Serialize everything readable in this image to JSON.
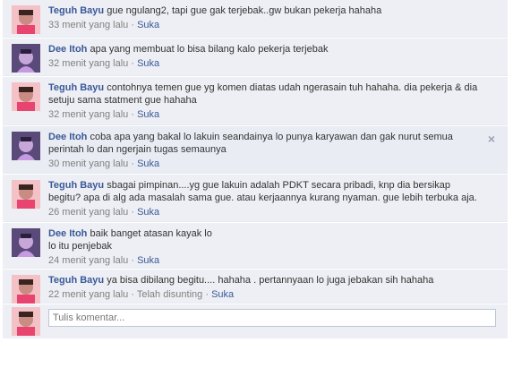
{
  "comments": [
    {
      "author": "Teguh Bayu",
      "avatar": "teguh",
      "text": "gue ngulang2, tapi gue gak terjebak..gw bukan pekerja hahaha",
      "time": "33 menit yang lalu",
      "like": "Suka",
      "extra": ""
    },
    {
      "author": "Dee Itoh",
      "avatar": "dee",
      "text": "apa yang membuat lo bisa bilang kalo pekerja terjebak",
      "time": "32 menit yang lalu",
      "like": "Suka",
      "extra": ""
    },
    {
      "author": "Teguh Bayu",
      "avatar": "teguh",
      "text": "contohnya temen gue yg komen diatas udah ngerasain tuh hahaha. dia pekerja & dia setuju sama statment gue hahaha",
      "time": "32 menit yang lalu",
      "like": "Suka",
      "extra": ""
    },
    {
      "author": "Dee Itoh",
      "avatar": "dee",
      "text": "coba apa yang bakal lo lakuin seandainya lo punya karyawan dan gak nurut semua perintah lo dan ngerjain tugas semaunya",
      "time": "30 menit yang lalu",
      "like": "Suka",
      "extra": ""
    },
    {
      "author": "Teguh Bayu",
      "avatar": "teguh",
      "text": "sbagai pimpinan....yg gue lakuin adalah PDKT secara pribadi, knp dia bersikap begitu? apa di alg ada masalah sama gue. atau kerjaannya kurang nyaman. gue lebih terbuka aja.",
      "time": "26 menit yang lalu",
      "like": "Suka",
      "extra": ""
    },
    {
      "author": "Dee Itoh",
      "avatar": "dee",
      "text": "baik banget atasan kayak lo\nlo itu penjebak",
      "time": "24 menit yang lalu",
      "like": "Suka",
      "extra": ""
    },
    {
      "author": "Teguh Bayu",
      "avatar": "teguh",
      "text": "ya bisa dibilang begitu.... hahaha . pertannyaan lo juga jebakan sih hahaha",
      "time": "22 menit yang lalu",
      "like": "Suka",
      "extra": "Telah disunting"
    }
  ],
  "meta_separator": "·",
  "close_glyph": "×",
  "composer": {
    "placeholder": "Tulis komentar..."
  }
}
